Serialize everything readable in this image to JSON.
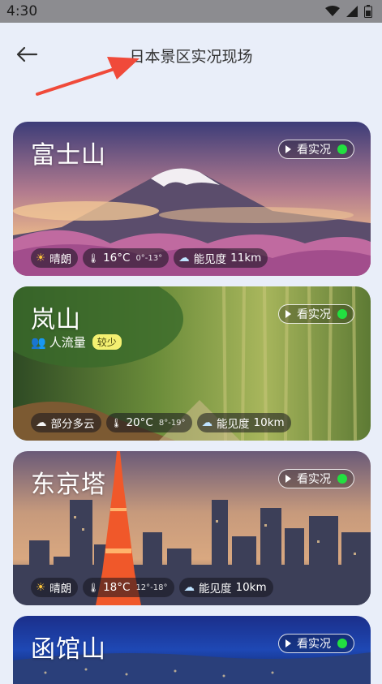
{
  "status_bar": {
    "time": "4:30"
  },
  "header": {
    "title": "日本景区实况现场"
  },
  "live_label": "看实况",
  "visibility_label": "能见度",
  "cards": [
    {
      "name": "富士山",
      "weather": "晴朗",
      "temp": "16°C",
      "range": "0°-13°",
      "visibility": "11km",
      "crowd": null
    },
    {
      "name": "岚山",
      "weather": "部分多云",
      "temp": "20°C",
      "range": "8°-19°",
      "visibility": "10km",
      "crowd": {
        "label": "人流量",
        "level": "较少"
      }
    },
    {
      "name": "东京塔",
      "weather": "晴朗",
      "temp": "18°C",
      "range": "12°-18°",
      "visibility": "10km",
      "crowd": null
    },
    {
      "name": "函馆山"
    }
  ],
  "colors": {
    "live_dot": "#22e040",
    "crowd_badge": "#f4f071",
    "background": "#e9eef9"
  }
}
